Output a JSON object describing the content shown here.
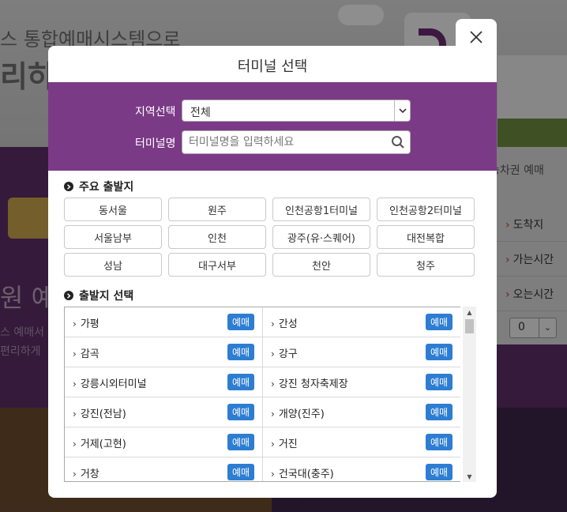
{
  "background": {
    "hero_line1": "스 통합예매시스템으로",
    "hero_line2": "리하게",
    "right_header": "승차권 예매",
    "right_items": [
      "도착지",
      "가는시간",
      "오는시간"
    ],
    "count_select_value": "0",
    "big_text": "원 예",
    "small_text1": "스 예매서",
    "small_text2": "편리하게"
  },
  "modal": {
    "title": "터미널 선택",
    "region_label": "지역선택",
    "region_value": "전체",
    "terminal_label": "터미널명",
    "terminal_placeholder": "터미널명을 입력하세요",
    "main_section_title": "주요 출발지",
    "main_terminals": [
      "동서울",
      "원주",
      "인천공항1터미널",
      "인천공항2터미널",
      "서울남부",
      "인천",
      "광주(유·스퀘어)",
      "대전복합",
      "성남",
      "대구서부",
      "천안",
      "청주"
    ],
    "list_section_title": "출발지 선택",
    "book_label": "예매",
    "terminal_rows": [
      [
        "가평",
        "간성"
      ],
      [
        "감곡",
        "강구"
      ],
      [
        "강릉시외터미널",
        "강진 청자축제장"
      ],
      [
        "강진(전남)",
        "개양(진주)"
      ],
      [
        "거제(고현)",
        "거진"
      ],
      [
        "거창",
        "건국대(충주)"
      ]
    ]
  },
  "colors": {
    "panel_purple": "#7b3a86",
    "book_button_blue": "#2d7dd2"
  }
}
